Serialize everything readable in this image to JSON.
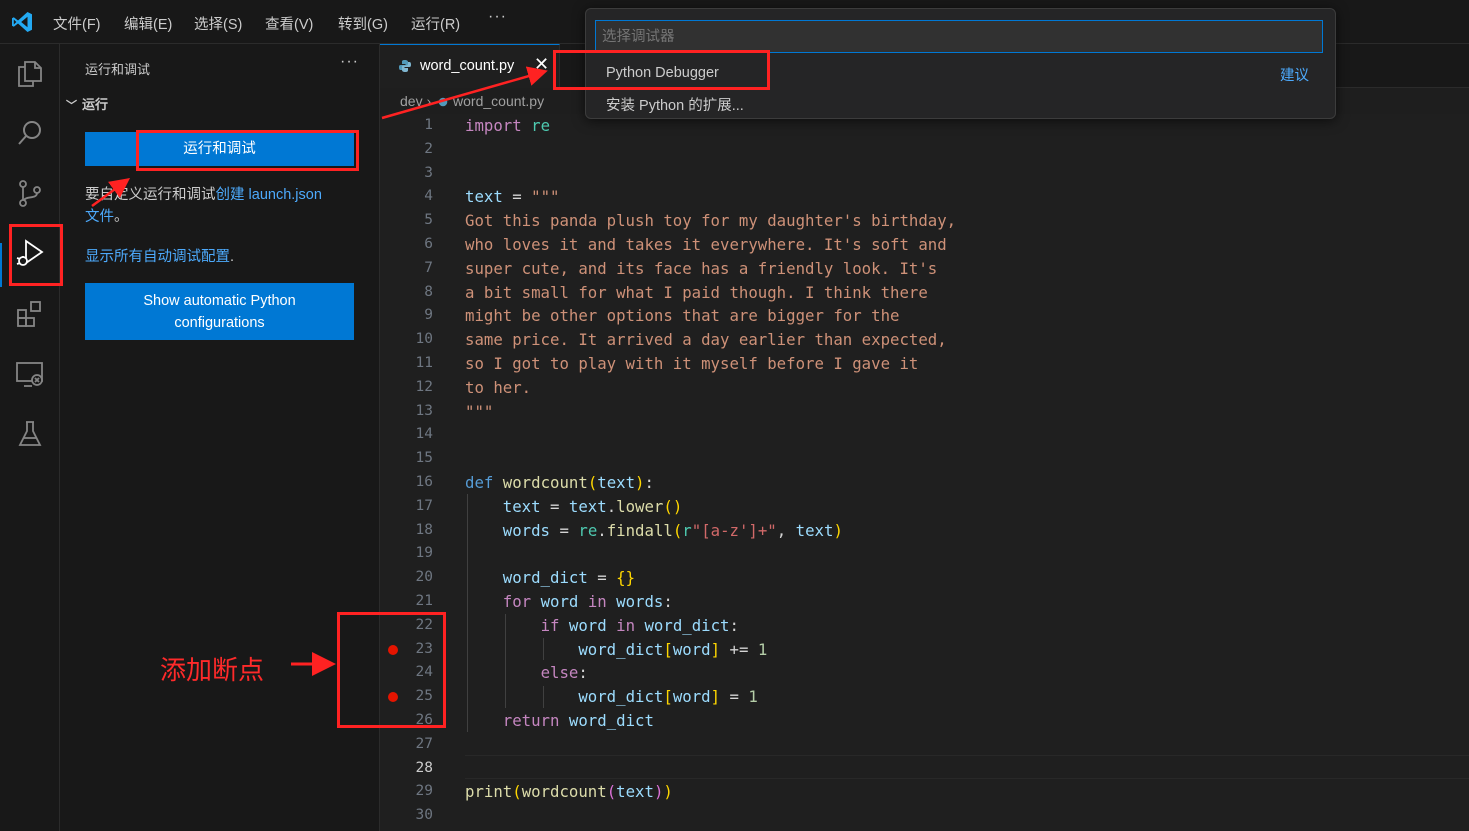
{
  "menu": {
    "items": [
      "文件(F)",
      "编辑(E)",
      "选择(S)",
      "查看(V)",
      "转到(G)",
      "运行(R)"
    ],
    "more": "···"
  },
  "activity_bar": {
    "icons": [
      "explorer-icon",
      "search-icon",
      "source-control-icon",
      "run-debug-icon",
      "extensions-icon",
      "remote-explorer-icon",
      "testing-icon"
    ],
    "active": "run-debug-icon"
  },
  "sidebar": {
    "title": "运行和调试",
    "more": "···",
    "section": "运行",
    "run_button": "运行和调试",
    "customize_prefix": "要自定义运行和调试",
    "customize_link": "创建 launch.json",
    "customize_link2": "文件",
    "customize_suffix": "。",
    "show_all_link": "显示所有自动调试配置",
    "show_all_suffix": ".",
    "python_button_line1": "Show automatic Python",
    "python_button_line2": "configurations"
  },
  "editor": {
    "tab_label": "word_count.py",
    "tab_close": "✕",
    "breadcrumb_folder": "dev",
    "breadcrumb_sep": "›",
    "breadcrumb_file": "word_count.py",
    "active_line": 28,
    "breakpoints": [
      23,
      25
    ]
  },
  "code_lines": [
    "import re",
    "",
    "",
    "text = \"\"\"",
    "Got this panda plush toy for my daughter's birthday,",
    "who loves it and takes it everywhere. It's soft and",
    "super cute, and its face has a friendly look. It's",
    "a bit small for what I paid though. I think there",
    "might be other options that are bigger for the",
    "same price. It arrived a day earlier than expected,",
    "so I got to play with it myself before I gave it",
    "to her.",
    "\"\"\"",
    "",
    "",
    "def wordcount(text):",
    "    text = text.lower()",
    "    words = re.findall(r\"[a-z']+\", text)",
    "",
    "    word_dict = {}",
    "    for word in words:",
    "        if word in word_dict:",
    "            word_dict[word] += 1",
    "        else:",
    "            word_dict[word] = 1",
    "    return word_dict",
    "",
    "",
    "print(wordcount(text))",
    ""
  ],
  "quick_pick": {
    "placeholder": "选择调试器",
    "items": [
      "Python Debugger",
      "安装 Python 的扩展..."
    ],
    "suggestion_label": "建议"
  },
  "annotation": {
    "breakpoint_label": "添加断点",
    "color": "#ff2222"
  }
}
